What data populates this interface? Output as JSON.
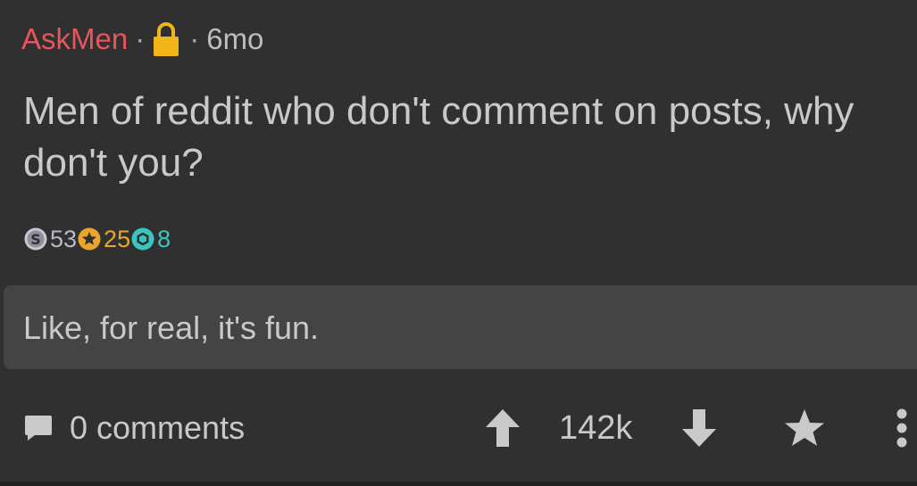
{
  "post": {
    "subreddit": "AskMen",
    "separator": "·",
    "age": "6mo",
    "title": "Men of reddit who don't comment on posts, why don't you?",
    "body": "Like, for real, it's fun."
  },
  "awards": [
    {
      "icon": "silver-award-icon",
      "count": "53",
      "color": "#b9b9c4"
    },
    {
      "icon": "gold-award-icon",
      "count": "25",
      "color": "#e9a62b"
    },
    {
      "icon": "platinum-award-icon",
      "count": "8",
      "color": "#39c6c0"
    }
  ],
  "actions": {
    "comments_label": "0 comments",
    "score": "142k"
  },
  "colors": {
    "background": "#303030",
    "subreddit": "#e8555c",
    "text": "#c9c9c9",
    "body_box": "#444444",
    "lock": "#f2b518"
  }
}
